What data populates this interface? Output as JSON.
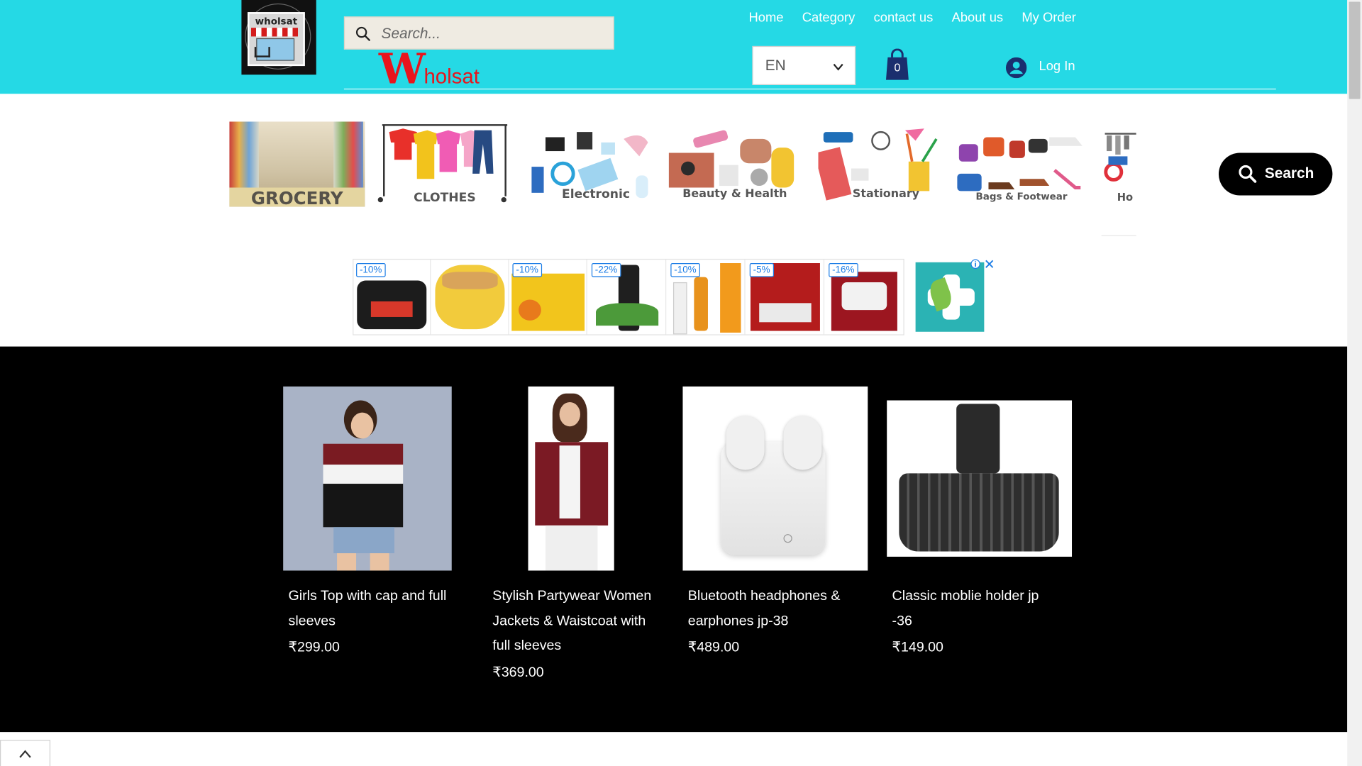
{
  "header": {
    "logo_text": "wholsat",
    "brand_name_big": "W",
    "brand_name_rest": "holsat",
    "search_placeholder": "Search...",
    "nav": [
      {
        "label": "Home"
      },
      {
        "label": "Category"
      },
      {
        "label": "contact us"
      },
      {
        "label": "About us"
      },
      {
        "label": "My Order"
      }
    ],
    "language": "EN",
    "cart_count": "0",
    "login_label": "Log In",
    "bg_color": "#25d9e5"
  },
  "categories": [
    {
      "label": "GROCERY"
    },
    {
      "label": "CLOTHES"
    },
    {
      "label": "Electronic"
    },
    {
      "label": "Beauty & Health"
    },
    {
      "label": "Stationary"
    },
    {
      "label": "Bags & Footwear"
    },
    {
      "label": "Ho"
    }
  ],
  "search_button": {
    "label": "Search"
  },
  "ads": {
    "items": [
      {
        "discount": "-10%"
      },
      {
        "discount": ""
      },
      {
        "discount": "-10%"
      },
      {
        "discount": "-22%"
      },
      {
        "discount": "-10%"
      },
      {
        "discount": "-5%"
      },
      {
        "discount": "-16%"
      }
    ]
  },
  "products": [
    {
      "name": "Girls Top with cap and full sleeves",
      "price": "₹299.00"
    },
    {
      "name": "Stylish Partywear Women Jackets & Waistcoat with full sleeves",
      "price": "₹369.00"
    },
    {
      "name": "Bluetooth headphones & earphones jp-38",
      "price": "₹489.00"
    },
    {
      "name": "Classic moblie holder jp -36",
      "price": "₹149.00"
    }
  ],
  "colors": {
    "accent": "#25d9e5",
    "brand_red": "#e8141c",
    "discount_blue": "#1e7ee6",
    "cart_navy": "#1a2f6e"
  }
}
